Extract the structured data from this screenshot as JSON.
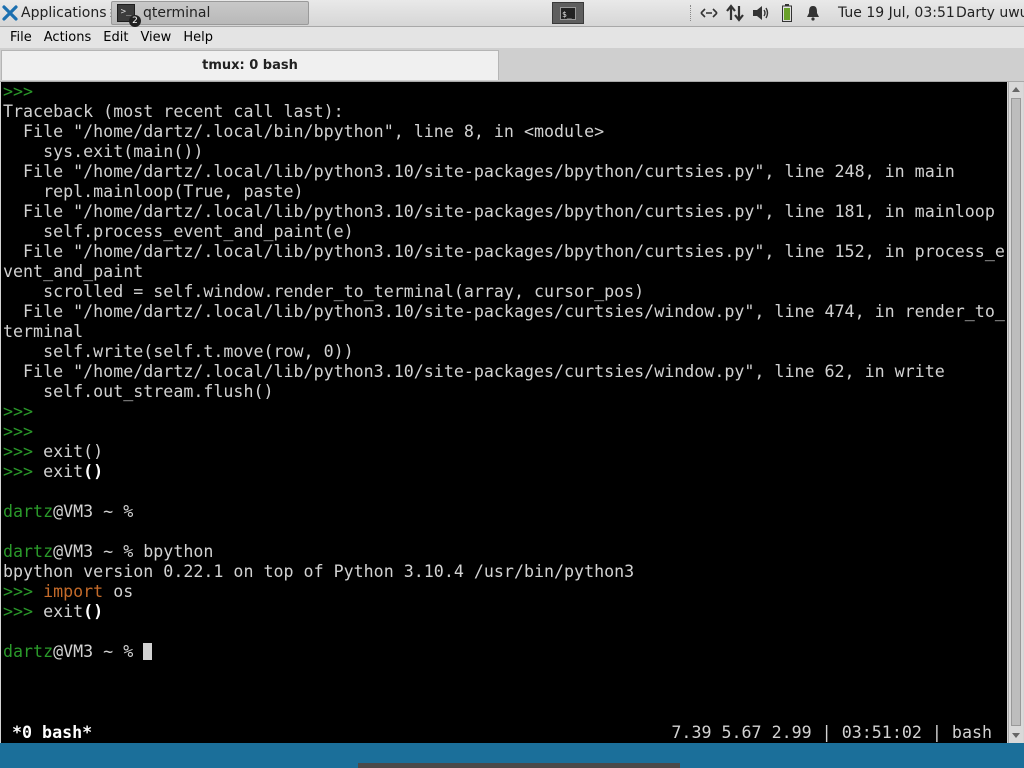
{
  "panel": {
    "applications_label": "Applications",
    "menu_glyph": "☰",
    "task_title": "qterminal",
    "task_badge": "2",
    "clock": "Tue 19 Jul, 03:51",
    "user": "Darty uwu",
    "tray_icons": [
      "network-arrows-icon",
      "transfer-icon",
      "volume-icon",
      "battery-icon",
      "bell-icon"
    ]
  },
  "menubar": {
    "file": "File",
    "actions": "Actions",
    "edit": "Edit",
    "view": "View",
    "help": "Help"
  },
  "tab": {
    "title": "tmux: 0 bash"
  },
  "terminal": {
    "lines": [
      [
        {
          "t": ">>>",
          "c": "g"
        }
      ],
      [
        {
          "t": "Traceback (most recent call last):"
        }
      ],
      [
        {
          "t": "  File \"/home/dartz/.local/bin/bpython\", line 8, in <module>"
        }
      ],
      [
        {
          "t": "    sys.exit(main())"
        }
      ],
      [
        {
          "t": "  File \"/home/dartz/.local/lib/python3.10/site-packages/bpython/curtsies.py\", line 248, in main"
        }
      ],
      [
        {
          "t": "    repl.mainloop(True, paste)"
        }
      ],
      [
        {
          "t": "  File \"/home/dartz/.local/lib/python3.10/site-packages/bpython/curtsies.py\", line 181, in mainloop"
        }
      ],
      [
        {
          "t": "    self.process_event_and_paint(e)"
        }
      ],
      [
        {
          "t": "  File \"/home/dartz/.local/lib/python3.10/site-packages/bpython/curtsies.py\", line 152, in process_e"
        }
      ],
      [
        {
          "t": "vent_and_paint"
        }
      ],
      [
        {
          "t": "    scrolled = self.window.render_to_terminal(array, cursor_pos)"
        }
      ],
      [
        {
          "t": "  File \"/home/dartz/.local/lib/python3.10/site-packages/curtsies/window.py\", line 474, in render_to_"
        }
      ],
      [
        {
          "t": "terminal"
        }
      ],
      [
        {
          "t": "    self.write(self.t.move(row, 0))"
        }
      ],
      [
        {
          "t": "  File \"/home/dartz/.local/lib/python3.10/site-packages/curtsies/window.py\", line 62, in write"
        }
      ],
      [
        {
          "t": "    self.out_stream.flush()"
        }
      ],
      [
        {
          "t": ">>>",
          "c": "g"
        }
      ],
      [
        {
          "t": ">>>",
          "c": "g"
        }
      ],
      [
        {
          "t": ">>>",
          "c": "g"
        },
        {
          "t": " exit()"
        }
      ],
      [
        {
          "t": ">>>",
          "c": "g"
        },
        {
          "t": " exit"
        },
        {
          "t": "()",
          "c": "b"
        }
      ],
      [],
      [
        {
          "t": "dartz",
          "c": "g"
        },
        {
          "t": "@VM3 ~ %"
        }
      ],
      [],
      [
        {
          "t": "dartz",
          "c": "g"
        },
        {
          "t": "@VM3 ~ % bpython"
        }
      ],
      [
        {
          "t": "bpython version 0.22.1 on top of Python 3.10.4 /usr/bin/python3"
        }
      ],
      [
        {
          "t": ">>>",
          "c": "g"
        },
        {
          "t": " "
        },
        {
          "t": "import",
          "c": "o"
        },
        {
          "t": " os"
        }
      ],
      [
        {
          "t": ">>>",
          "c": "g"
        },
        {
          "t": " exit"
        },
        {
          "t": "()",
          "c": "b"
        }
      ],
      [],
      [
        {
          "t": "dartz",
          "c": "g"
        },
        {
          "t": "@VM3 ~ % "
        },
        {
          "cursor": true
        }
      ]
    ]
  },
  "status": {
    "left": "*0 bash*",
    "right": "7.39 5.67 2.99 | 03:51:02 | bash"
  }
}
